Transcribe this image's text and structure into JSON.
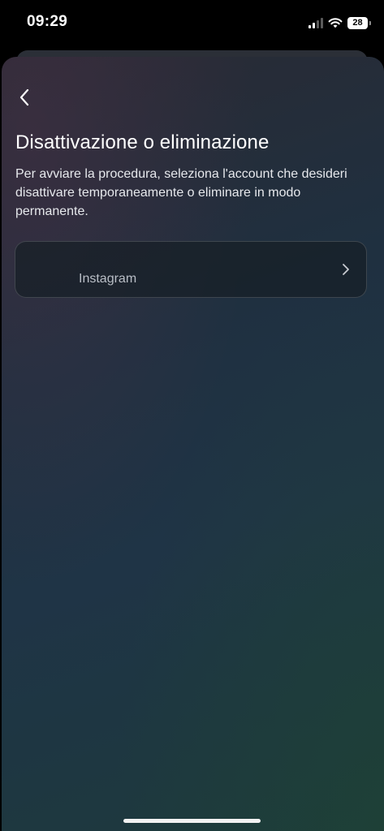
{
  "status_bar": {
    "time": "09:29",
    "battery_level": "28",
    "signal_bars_active": 2,
    "signal_bars_total": 4,
    "wifi": "wifi-icon"
  },
  "header": {
    "back_icon": "chevron-left-icon"
  },
  "main": {
    "title": "Disattivazione o eliminazione",
    "description": "Per avviare la procedura, seleziona l'account che desideri disattivare temporaneamente o eliminare in modo permanente."
  },
  "accounts": [
    {
      "label": "Instagram",
      "icon": "chevron-right-icon"
    }
  ],
  "colors": {
    "text_primary": "#ffffff",
    "text_secondary": "#b9bec6"
  }
}
